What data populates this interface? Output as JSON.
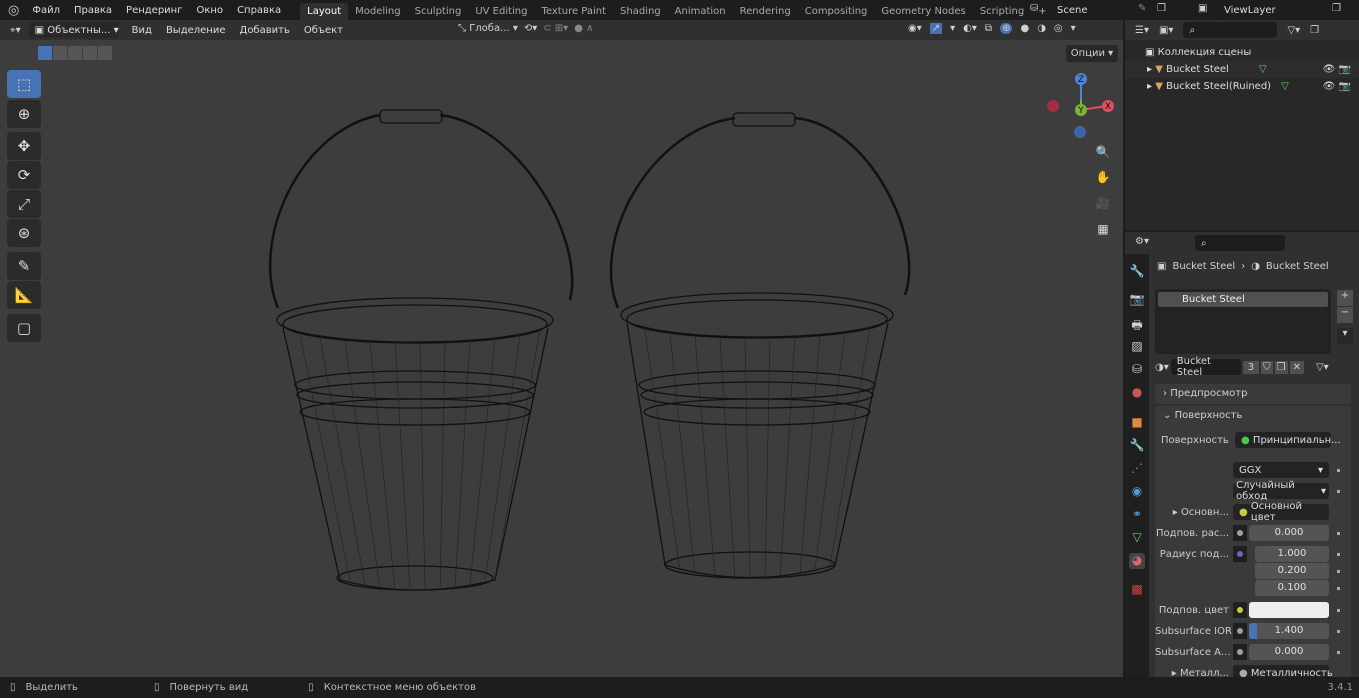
{
  "menu": [
    "Файл",
    "Правка",
    "Рендеринг",
    "Окно",
    "Справка"
  ],
  "workspaces": [
    "Layout",
    "Modeling",
    "Sculpting",
    "UV Editing",
    "Texture Paint",
    "Shading",
    "Animation",
    "Rendering",
    "Compositing",
    "Geometry Nodes",
    "Scripting"
  ],
  "active_workspace": "Layout",
  "scene": "Scene",
  "view_layer": "ViewLayer",
  "viewport_header": {
    "mode": "Объектны...",
    "menus": [
      "Вид",
      "Выделение",
      "Добавить",
      "Объект"
    ],
    "orientation": "Глоба...",
    "options": "Опции"
  },
  "gizmo": {
    "z": "Z",
    "y": "Y",
    "x": "X"
  },
  "outliner": {
    "collection": "Коллекция сцены",
    "items": [
      "Bucket Steel",
      "Bucket Steel(Ruined)"
    ]
  },
  "properties": {
    "breadcrumb": [
      "Bucket Steel",
      "Bucket Steel"
    ],
    "slot": "Bucket Steel",
    "material": "Bucket Steel",
    "users": "3",
    "panels": {
      "preview": "Предпросмотр",
      "surface": "Поверхность"
    },
    "surface_label": "Поверхность",
    "surface_value": "Принципиальн...",
    "distribution": "GGX",
    "subsurface_method": "Случайный обход",
    "rows": [
      {
        "label": "Основн...",
        "value": "Основной цвет"
      },
      {
        "label": "Подпов. рас...",
        "value": "0.000"
      },
      {
        "label": "Радиус под...",
        "values": [
          "1.000",
          "0.200",
          "0.100"
        ]
      },
      {
        "label": "Подпов. цвет"
      },
      {
        "label": "Subsurface IOR",
        "value": "1.400"
      },
      {
        "label": "Subsurface A...",
        "value": "0.000"
      },
      {
        "label": "Металл...",
        "value": "Металличность"
      }
    ]
  },
  "status": {
    "select": "Выделить",
    "rotate": "Повернуть вид",
    "context": "Контекстное меню объектов",
    "version": "3.4.1"
  },
  "colors": {
    "accent": "#4772b3",
    "viewport": "#3d3d3d"
  }
}
